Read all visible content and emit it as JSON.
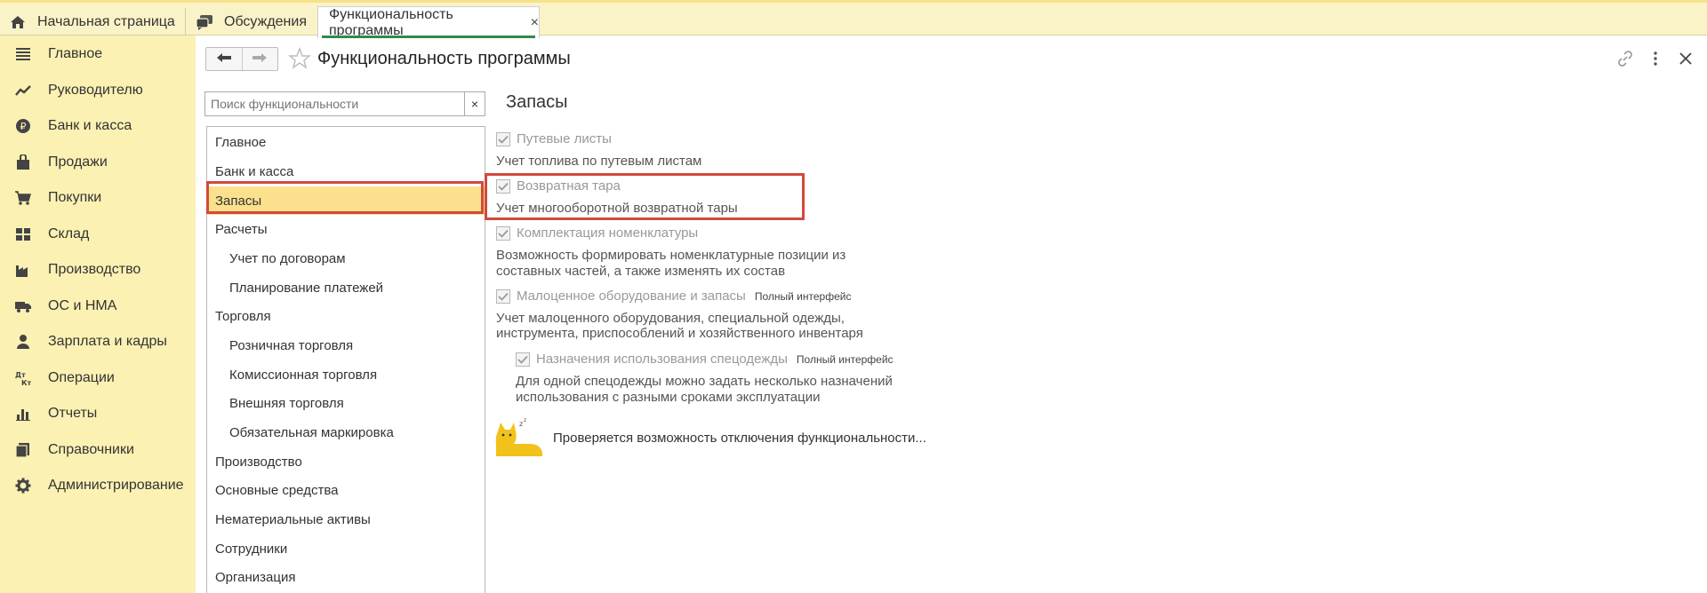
{
  "tabs": [
    {
      "label": "Начальная страница",
      "icon": "home-icon"
    },
    {
      "label": "Обсуждения",
      "icon": "discussions-icon"
    },
    {
      "label": "Функциональность программы",
      "icon": "",
      "close": "×"
    }
  ],
  "sidebar": {
    "items": [
      {
        "label": "Главное",
        "icon": "menu-lines-icon"
      },
      {
        "label": "Руководителю",
        "icon": "trend-icon"
      },
      {
        "label": "Банк и касса",
        "icon": "ruble-coin-icon"
      },
      {
        "label": "Продажи",
        "icon": "bag-icon"
      },
      {
        "label": "Покупки",
        "icon": "cart-icon"
      },
      {
        "label": "Склад",
        "icon": "warehouse-icon"
      },
      {
        "label": "Производство",
        "icon": "factory-icon"
      },
      {
        "label": "ОС и НМА",
        "icon": "truck-icon"
      },
      {
        "label": "Зарплата и кадры",
        "icon": "person-icon"
      },
      {
        "label": "Операции",
        "icon": "dt-kt-icon"
      },
      {
        "label": "Отчеты",
        "icon": "bar-chart-icon"
      },
      {
        "label": "Справочники",
        "icon": "books-icon"
      },
      {
        "label": "Администрирование",
        "icon": "gear-icon"
      }
    ]
  },
  "header": {
    "title": "Функциональность программы",
    "back_icon": "arrow-left-icon",
    "forward_icon": "arrow-right-icon",
    "favorite_icon": "star-icon",
    "link_icon": "link-icon",
    "more_icon": "more-vertical-icon",
    "close_icon": "close-icon"
  },
  "search": {
    "placeholder": "Поиск функциональности",
    "value": "",
    "clear": "×"
  },
  "tree": {
    "items": [
      {
        "label": "Главное",
        "level": 0,
        "selected": false
      },
      {
        "label": "Банк и касса",
        "level": 0,
        "selected": false
      },
      {
        "label": "Запасы",
        "level": 0,
        "selected": true
      },
      {
        "label": "Расчеты",
        "level": 0,
        "selected": false
      },
      {
        "label": "Учет по договорам",
        "level": 1,
        "selected": false
      },
      {
        "label": "Планирование платежей",
        "level": 1,
        "selected": false
      },
      {
        "label": "Торговля",
        "level": 0,
        "selected": false
      },
      {
        "label": "Розничная торговля",
        "level": 1,
        "selected": false
      },
      {
        "label": "Комиссионная торговля",
        "level": 1,
        "selected": false
      },
      {
        "label": "Внешняя торговля",
        "level": 1,
        "selected": false
      },
      {
        "label": "Обязательная маркировка",
        "level": 1,
        "selected": false
      },
      {
        "label": "Производство",
        "level": 0,
        "selected": false
      },
      {
        "label": "Основные средства",
        "level": 0,
        "selected": false
      },
      {
        "label": "Нематериальные активы",
        "level": 0,
        "selected": false
      },
      {
        "label": "Сотрудники",
        "level": 0,
        "selected": false
      },
      {
        "label": "Организация",
        "level": 0,
        "selected": false
      }
    ]
  },
  "content": {
    "section_title": "Запасы",
    "options": [
      {
        "label": "Путевые листы",
        "checked": true,
        "desc": "Учет топлива по путевым листам",
        "tag": ""
      },
      {
        "label": "Возвратная тара",
        "checked": true,
        "desc": "Учет многооборотной возвратной тары",
        "tag": ""
      },
      {
        "label": "Комплектация номенклатуры",
        "checked": true,
        "desc": "Возможность формировать номенклатурные позиции из",
        "desc2": "составных частей, а также изменять их состав",
        "tag": ""
      },
      {
        "label": "Малоценное оборудование и запасы",
        "checked": true,
        "desc": "Учет малоценного оборудования, специальной одежды,",
        "desc2": "инструмента, приспособлений и хозяйственного инвентаря",
        "tag": "Полный интерфейс"
      },
      {
        "label": "Назначения использования спецодежды",
        "checked": true,
        "desc": "Для одной спецодежды можно задать несколько назначений",
        "desc2": "использования с разными сроками эксплуатации",
        "tag": "Полный интерфейс"
      }
    ],
    "status": "Проверяется возможность отключения функциональности...",
    "status_icon": "waiting-cat-icon"
  },
  "colors": {
    "sidebar_bg": "#fbf1b3",
    "topbar_bg": "#fbf3c8",
    "selected_bg": "#fbe08d",
    "highlight_border": "#d04a3c",
    "active_tab_underline": "#2e8b4e"
  }
}
